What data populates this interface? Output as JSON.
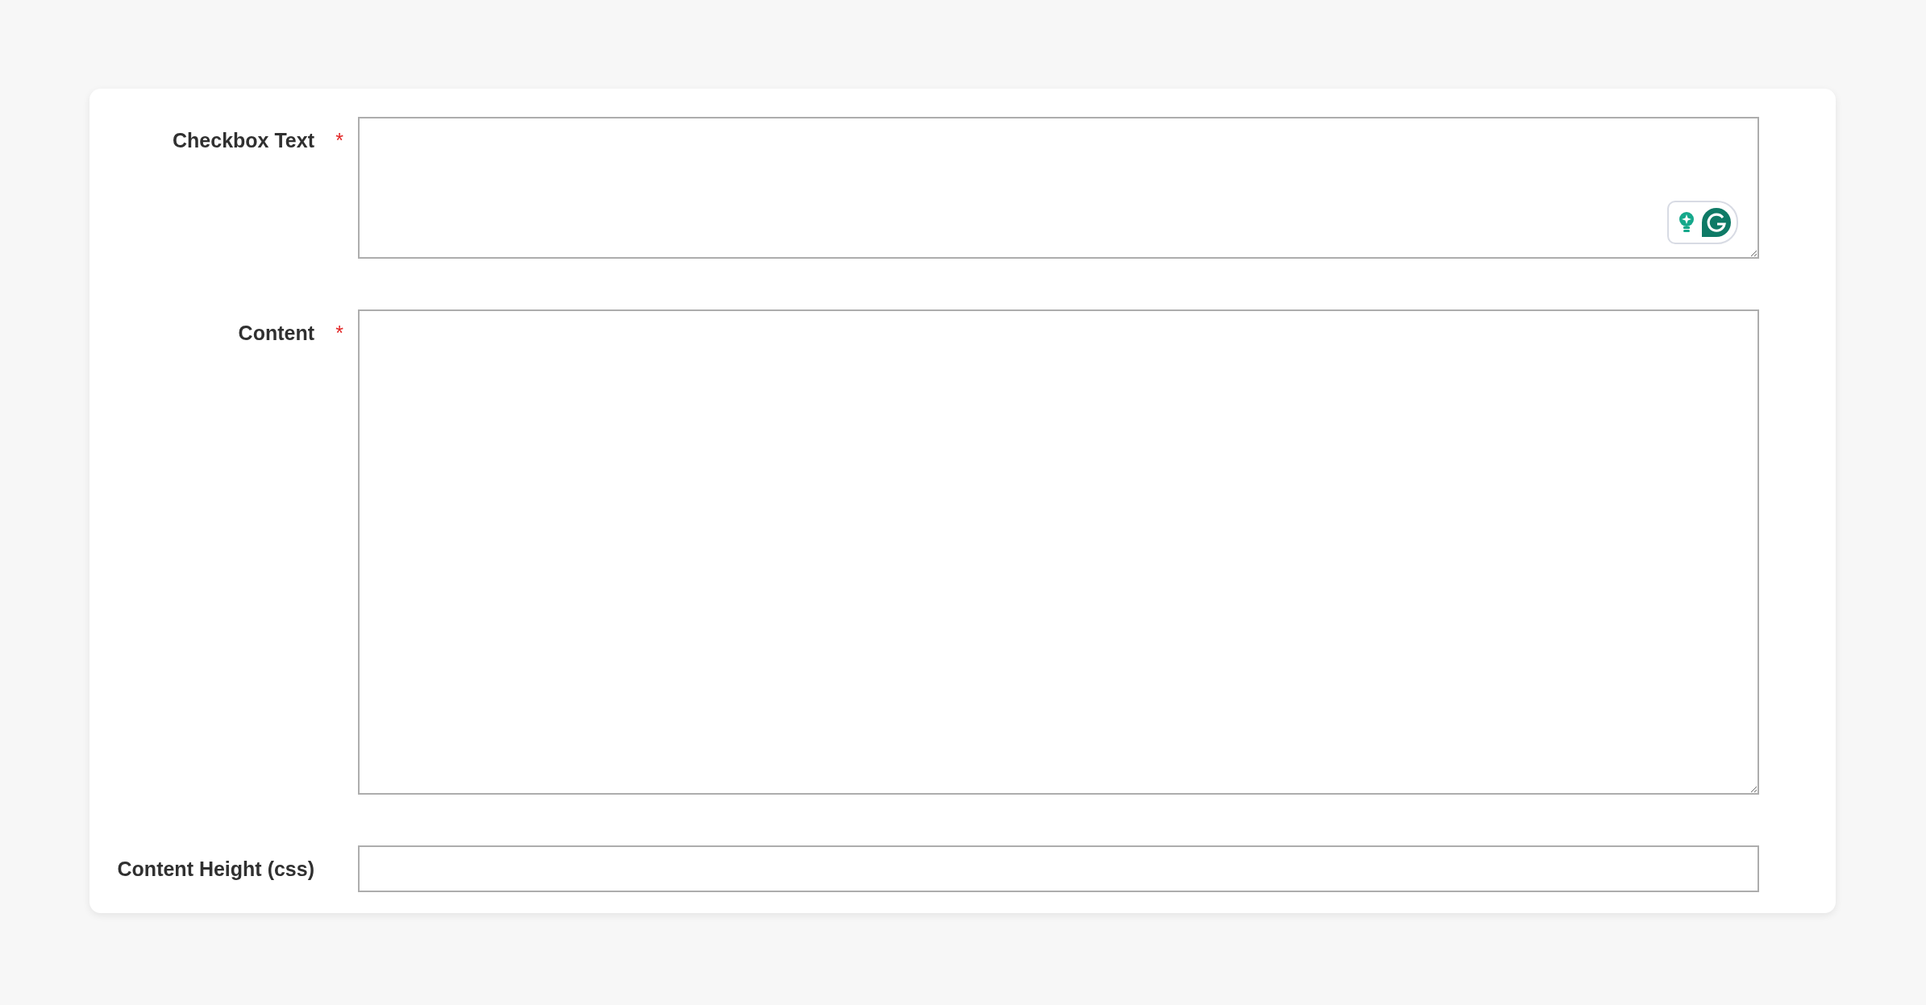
{
  "form": {
    "fields": [
      {
        "label": "Checkbox Text",
        "required_mark": "*",
        "kind": "textarea",
        "writing_assistant": true
      },
      {
        "label": "Content",
        "required_mark": "*",
        "kind": "textarea",
        "writing_assistant": false
      },
      {
        "label": "Content Height (css)",
        "kind": "input",
        "writing_assistant": false
      }
    ]
  }
}
